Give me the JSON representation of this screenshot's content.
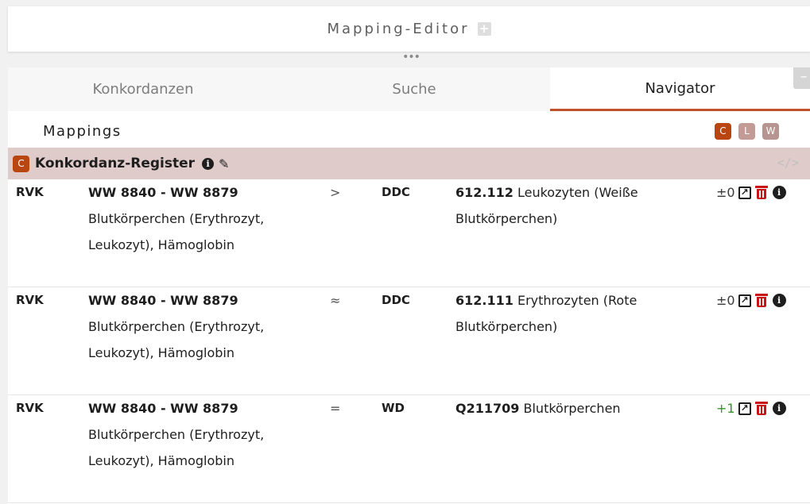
{
  "header": {
    "title": "Mapping-Editor",
    "expand_symbol": "+"
  },
  "resize_handle": "•••",
  "tabs": [
    {
      "label": "Konkordanzen",
      "active": false
    },
    {
      "label": "Suche",
      "active": false
    },
    {
      "label": "Navigator",
      "active": true
    }
  ],
  "minimize_symbol": "–",
  "mappings": {
    "heading": "Mappings",
    "registry_badges": [
      "C",
      "L",
      "W"
    ],
    "registry": {
      "badge": "C",
      "name": "Konkordanz-Register",
      "code_symbol": "</>"
    },
    "rows": [
      {
        "from_scheme": "RVK",
        "from_notation": "WW 8840 - WW 8879",
        "from_label": "Blutkörperchen (Erythrozyt, Leukozyt), Hämoglobin",
        "relation": ">",
        "to_scheme": "DDC",
        "to_notation": "612.112",
        "to_label": "Leukozyten (Weiße Blutkörperchen)",
        "score": "±0"
      },
      {
        "from_scheme": "RVK",
        "from_notation": "WW 8840 - WW 8879",
        "from_label": "Blutkörperchen (Erythrozyt, Leukozyt), Hämoglobin",
        "relation": "≈",
        "to_scheme": "DDC",
        "to_notation": "612.111",
        "to_label": "Erythrozyten (Rote Blutkörperchen)",
        "score": "±0"
      },
      {
        "from_scheme": "RVK",
        "from_notation": "WW 8840 - WW 8879",
        "from_label": "Blutkörperchen (Erythrozyt, Leukozyt), Hämoglobin",
        "relation": "=",
        "to_scheme": "WD",
        "to_notation": "Q211709",
        "to_label": "Blutkörperchen",
        "score": "+1"
      }
    ]
  },
  "colors": {
    "accent": "#c0522b",
    "registry_bar": "#dfcbc9",
    "delete_red": "#c81414",
    "positive_score": "#2f9a22"
  },
  "icons": {
    "info": "info-circle-icon",
    "edit_registry": "pencil-icon",
    "edit_mapping": "edit-square-icon",
    "delete_mapping": "trash-icon",
    "code": "code-icon"
  }
}
